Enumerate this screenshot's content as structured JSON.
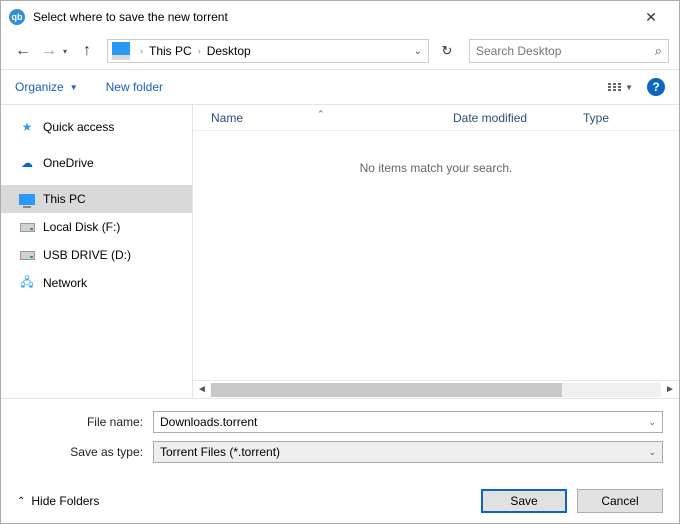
{
  "titlebar": {
    "title": "Select where to save the new torrent"
  },
  "breadcrumb": {
    "parts": [
      "This PC",
      "Desktop"
    ]
  },
  "search": {
    "placeholder": "Search Desktop"
  },
  "toolbar": {
    "organize": "Organize",
    "new_folder": "New folder"
  },
  "columns": {
    "name": "Name",
    "date": "Date modified",
    "type": "Type"
  },
  "sidebar": {
    "items": [
      {
        "label": "Quick access",
        "icon": "star"
      },
      {
        "label": "OneDrive",
        "icon": "cloud"
      },
      {
        "label": "This PC",
        "icon": "monitor",
        "selected": true
      },
      {
        "label": "Local Disk (F:)",
        "icon": "drive"
      },
      {
        "label": "USB DRIVE (D:)",
        "icon": "drive"
      },
      {
        "label": "Network",
        "icon": "network"
      }
    ]
  },
  "filelist": {
    "empty_message": "No items match your search."
  },
  "form": {
    "filename_label": "File name:",
    "filename_value": "Downloads.torrent",
    "savetype_label": "Save as type:",
    "savetype_value": "Torrent Files (*.torrent)"
  },
  "bottombar": {
    "hide_folders": "Hide Folders",
    "save": "Save",
    "cancel": "Cancel"
  }
}
